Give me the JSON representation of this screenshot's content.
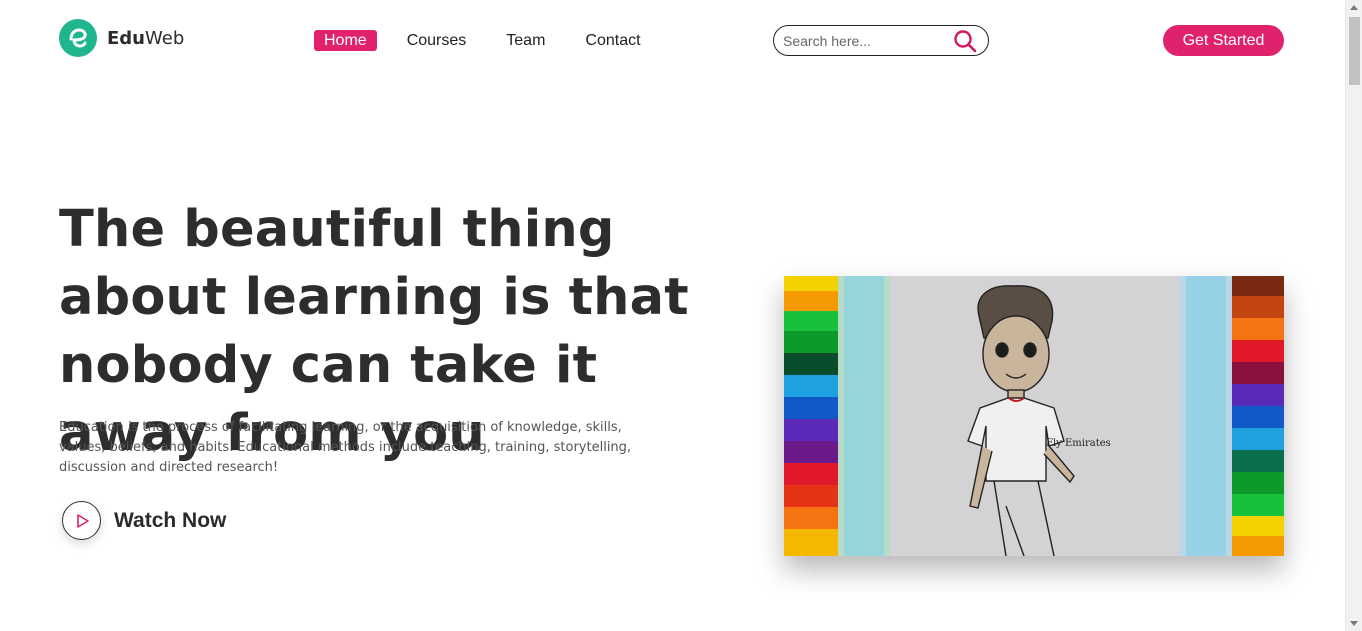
{
  "brand": {
    "name_bold": "Edu",
    "name_regular": "Web",
    "logo_icon": "edu-e-logo-icon",
    "color": "#1fb58f"
  },
  "nav": {
    "items": [
      {
        "label": "Home",
        "active": true
      },
      {
        "label": "Courses",
        "active": false
      },
      {
        "label": "Team",
        "active": false
      },
      {
        "label": "Contact",
        "active": false
      }
    ]
  },
  "search": {
    "placeholder": "Search here...",
    "icon": "search-icon"
  },
  "header": {
    "cta_label": "Get Started"
  },
  "hero": {
    "title": "The beautiful thing about learning is that nobody can take it away from you",
    "description": "Education is the process of facilitating learning, or the acquisition of knowledge, skills, values, beliefs, and habits. Educational methods include teaching, training, storytelling, discussion and directed research!",
    "watch_label": "Watch Now",
    "watch_icon": "play-icon",
    "image_alt": "cartoon-boy-drawing-with-colored-pencils",
    "drawing_text": "Fly Emirates"
  },
  "colors": {
    "accent": "#e0226e",
    "brand": "#1fb58f",
    "text": "#2d2d2d"
  }
}
